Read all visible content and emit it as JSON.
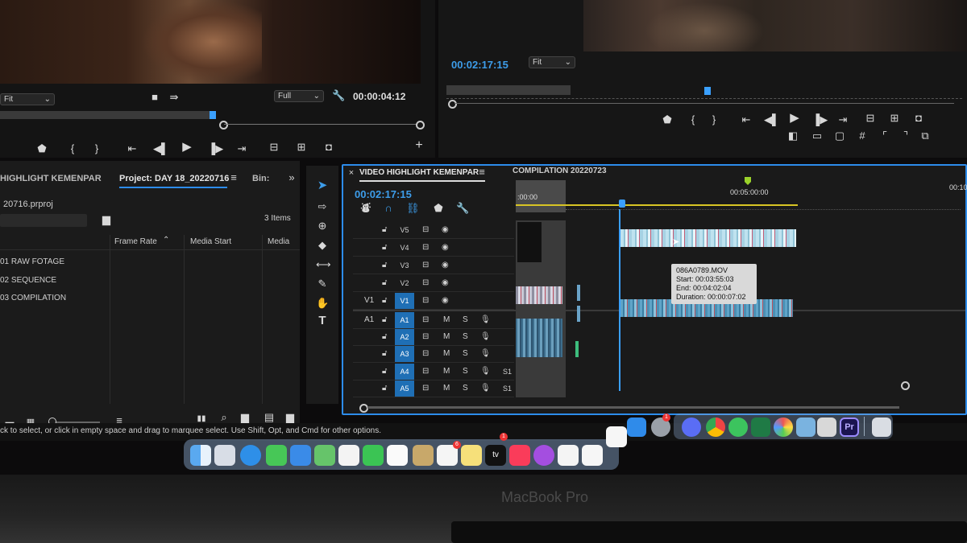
{
  "source_monitor": {
    "zoom": "Fit",
    "quality": "Full",
    "timecode": "00:00:04:12"
  },
  "program_monitor": {
    "timecode": "00:02:17:15",
    "zoom": "Fit"
  },
  "project_panel": {
    "tab_left": "HIGHLIGHT KEMENPAR",
    "tab_project": "Project: DAY 18_20220716",
    "tab_bin": "Bin:",
    "project_file": "20716.prproj",
    "item_count": "3 Items",
    "columns": [
      "Frame Rate",
      "Media Start",
      "Media"
    ],
    "items": [
      "01 RAW FOTAGE",
      "02 SEQUENCE",
      "03 COMPILATION"
    ]
  },
  "timeline": {
    "tab_active": "VIDEO HIGHLIGHT KEMENPAR",
    "tab_other": "COMPILATION 20220723",
    "timecode": "00:02:17:15",
    "ruler_left": ":00:00",
    "ruler_mid": "00:05:00:00",
    "ruler_right": "00:10",
    "video_tracks": [
      "V5",
      "V4",
      "V3",
      "V2",
      "V1"
    ],
    "audio_tracks": [
      "A1",
      "A2",
      "A3",
      "A4",
      "A5"
    ],
    "source_v": "V1",
    "source_a": "A1",
    "mute": "M",
    "solo": "S",
    "vol": "S1",
    "tooltip": {
      "name": "086A0789.MOV",
      "start": "Start: 00:03:55:03",
      "end": "End: 00:04:02:04",
      "duration": "Duration: 00:00:07:02"
    }
  },
  "status_bar": {
    "message": "ck to select, or click in empty space and drag to marquee select. Use Shift, Opt, and Cmd for other options."
  },
  "dock": {
    "badges": [
      "6",
      "1",
      "1"
    ],
    "pr_label": "Pr",
    "tv_label": "tv"
  },
  "laptop": {
    "brand": "MacBook Pro"
  },
  "colors": {
    "accent_blue": "#2d8ceb",
    "playhead": "#3aa0ff",
    "work_area": "#d8c424",
    "clip_audio": "#5fa4c8"
  }
}
